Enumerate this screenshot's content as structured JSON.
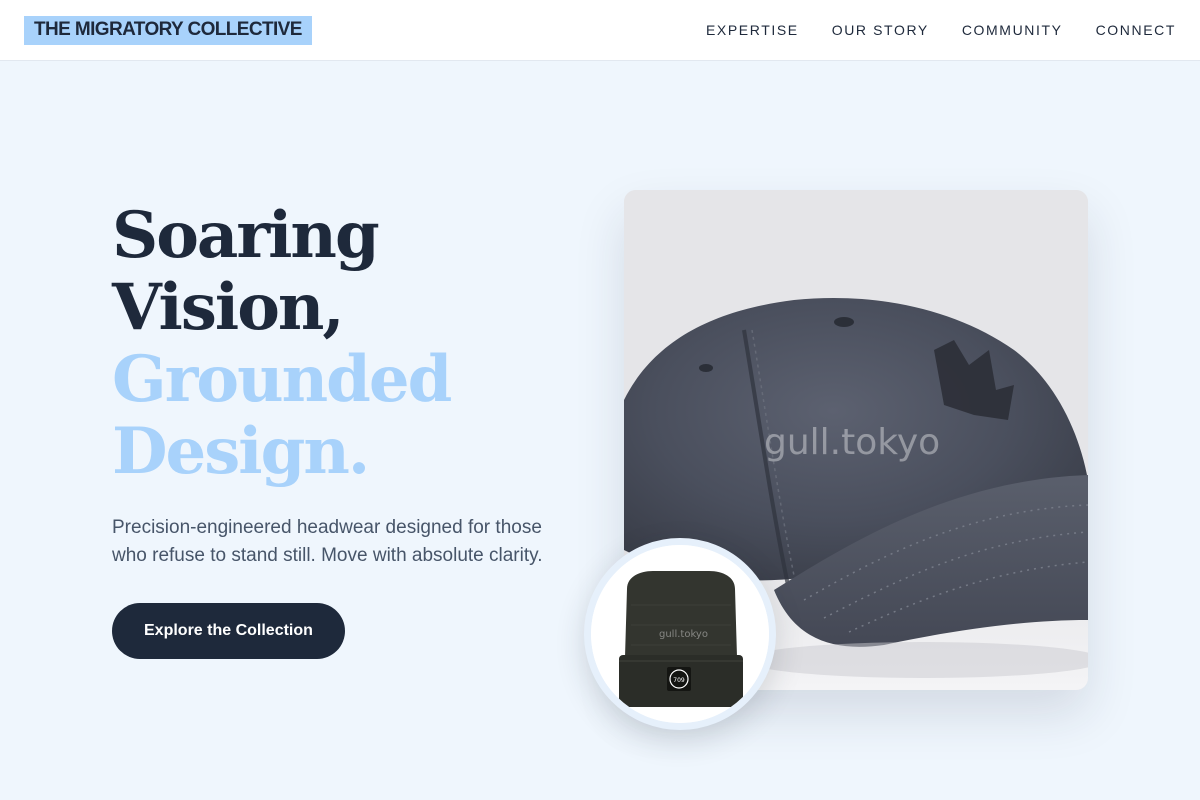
{
  "header": {
    "logo": "THE MIGRATORY COLLECTIVE",
    "nav": [
      "EXPERTISE",
      "OUR STORY",
      "COMMUNITY",
      "CONNECT"
    ]
  },
  "hero": {
    "title_line1": "Soaring",
    "title_line2": "Vision,",
    "title_line3": "Grounded",
    "title_line4": "Design.",
    "subtitle": "Precision-engineered headwear designed for those who refuse to stand still. Move with absolute clarity.",
    "cta": "Explore the Collection"
  },
  "images": {
    "main_watermark": "gull.tokyo",
    "thumb_watermark": "gull.tokyo",
    "thumb_patch": "709"
  },
  "colors": {
    "background": "#eff6fd",
    "dark": "#1e293b",
    "accent": "#a8d2fb",
    "muted": "#475569"
  }
}
